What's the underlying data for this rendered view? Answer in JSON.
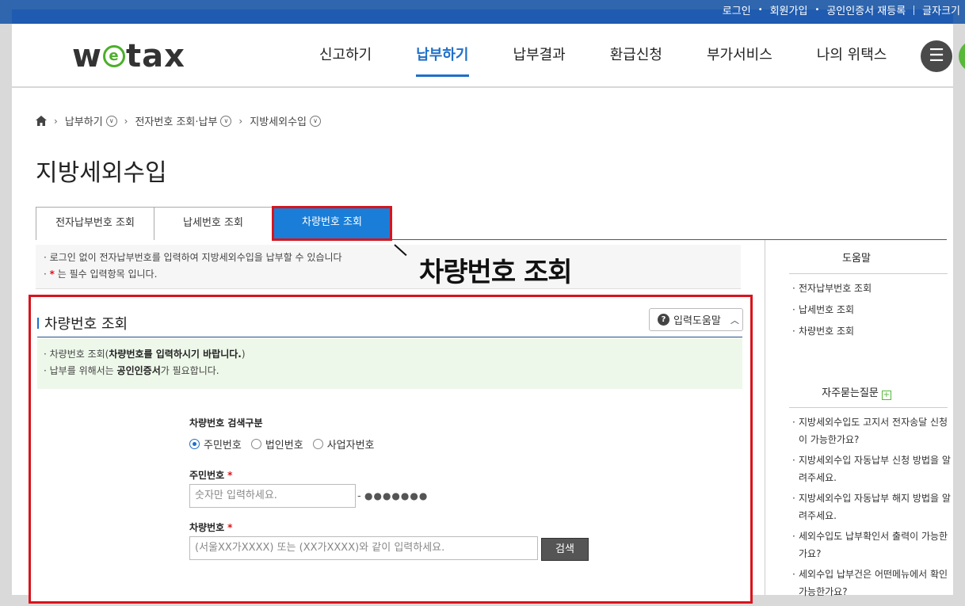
{
  "util": {
    "login": "로그인",
    "join": "회원가입",
    "cert": "공인인증서 재등록",
    "font": "글자크기"
  },
  "header": {
    "logo": "wetax",
    "nav": [
      "신고하기",
      "납부하기",
      "납부결과",
      "환급신청",
      "부가서비스",
      "나의 위택스"
    ],
    "active_nav": "납부하기"
  },
  "breadcrumb": [
    "납부하기",
    "전자번호 조회·납부",
    "지방세외수입"
  ],
  "page_title": "지방세외수입",
  "tabs": [
    "전자납부번호 조회",
    "납세번호 조회",
    "차량번호 조회"
  ],
  "callout": "차량번호 조회",
  "notice": {
    "line1": "· 로그인 없이 전자납부번호를 입력하여 지방세외수입을 납부할 수 있습니다",
    "line2_prefix": "· ",
    "line2_star": "*",
    "line2_text": " 는 필수 입력항목 입니다."
  },
  "form": {
    "title": "차량번호 조회",
    "help_label": "입력도움말",
    "guide1_a": "· 차량번호 조회(",
    "guide1_b": "차량번호를 입력하시기 바랍니다.",
    "guide1_c": ")",
    "guide2_a": "· 납부를 위해서는 ",
    "guide2_b": "공인인증서",
    "guide2_c": "가 필요합니다.",
    "search_type_label": "차량번호 검색구분",
    "radios": [
      "주민번호",
      "법인번호",
      "사업자번호"
    ],
    "rrn_label": "주민번호",
    "req": "*",
    "rrn_placeholder": "숫자만 입력하세요.",
    "rrn_dash": "-",
    "rrn_mask": "●●●●●●●",
    "car_label": "차량번호",
    "car_placeholder": "(서울XX가XXXX) 또는 (XX가XXXX)와 같이 입력하세요.",
    "search_button": "검색"
  },
  "sidebar": {
    "help_title": "도움말",
    "help_items": [
      "전자납부번호 조회",
      "납세번호 조회",
      "차량번호 조회"
    ],
    "faq_title": "자주묻는질문",
    "faq_items": [
      "지방세외수입도 고지서 전자송달 신청이 가능한가요?",
      "지방세외수입 자동납부 신청 방법을 알려주세요.",
      "지방세외수입 자동납부 해지 방법을 알려주세요.",
      "세외수입도 납부확인서 출력이 가능한가요?",
      "세외수입 납부건은 어떤메뉴에서 확인가능한가요?"
    ]
  }
}
